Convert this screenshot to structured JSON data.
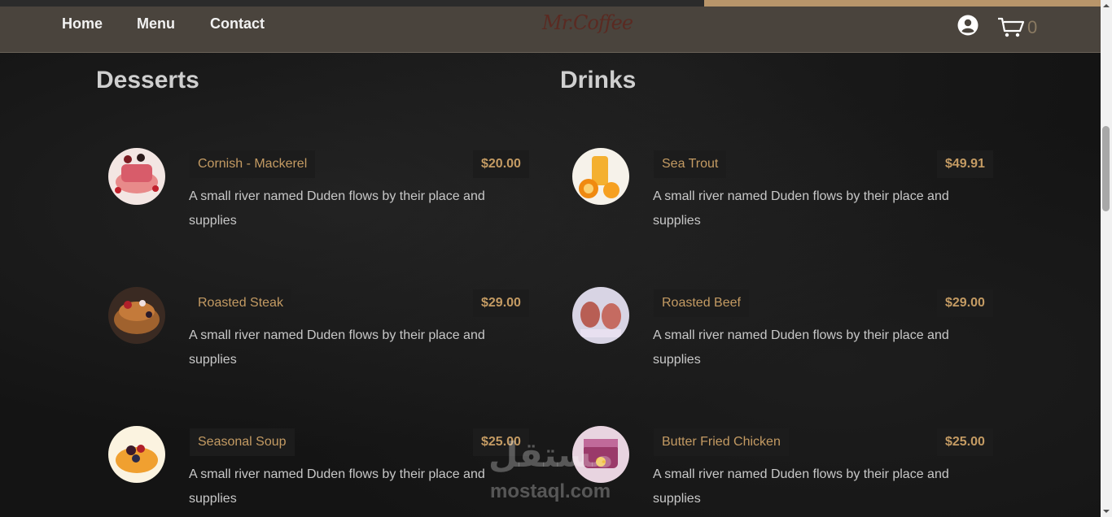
{
  "nav": {
    "links": [
      "Home",
      "Menu",
      "Contact"
    ],
    "logo": "Mr.Coffee",
    "cart_count": "0"
  },
  "sections": [
    {
      "title": "Desserts",
      "items": [
        {
          "name": "Cornish - Mackerel",
          "price": "$20.00",
          "desc": "A small river named Duden flows by their place and supplies"
        },
        {
          "name": "Roasted Steak",
          "price": "$29.00",
          "desc": "A small river named Duden flows by their place and supplies"
        },
        {
          "name": "Seasonal Soup",
          "price": "$25.00",
          "desc": "A small river named Duden flows by their place and supplies"
        }
      ]
    },
    {
      "title": "Drinks",
      "items": [
        {
          "name": "Sea Trout",
          "price": "$49.91",
          "desc": "A small river named Duden flows by their place and supplies"
        },
        {
          "name": "Roasted Beef",
          "price": "$29.00",
          "desc": "A small river named Duden flows by their place and supplies"
        },
        {
          "name": "Butter Fried Chicken",
          "price": "$25.00",
          "desc": "A small river named Duden flows by their place and supplies"
        }
      ]
    }
  ],
  "watermark": {
    "arabic": "مستقل",
    "latin": "mostaql.com"
  },
  "colors": {
    "accent": "#c49b63",
    "navbar": "#4a443d",
    "background": "#141414"
  }
}
